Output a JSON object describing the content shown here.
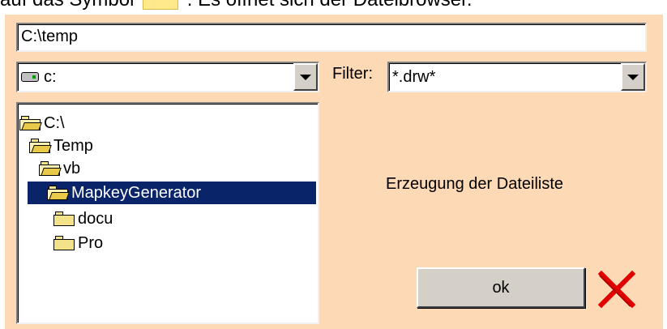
{
  "caption": {
    "prefix": "auf das Symbol",
    "suffix": ". Es öffnet sich der Dateibrowser."
  },
  "path_input": {
    "value": "C:\\temp"
  },
  "drive_select": {
    "value": "c:",
    "icon": "drive-icon"
  },
  "filter": {
    "label": "Filter:",
    "value": "*.drw*"
  },
  "tree": {
    "items": [
      {
        "label": "C:\\",
        "icon": "open-folder-icon",
        "selected": false
      },
      {
        "label": "Temp",
        "icon": "open-folder-icon",
        "selected": false
      },
      {
        "label": "vb",
        "icon": "open-folder-icon",
        "selected": false
      },
      {
        "label": "MapkeyGenerator",
        "icon": "open-folder-icon",
        "selected": true
      },
      {
        "label": "docu",
        "icon": "folder-icon",
        "selected": false
      },
      {
        "label": "Pro",
        "icon": "folder-icon",
        "selected": false
      }
    ]
  },
  "status": {
    "text": "Erzeugung der Dateiliste"
  },
  "ok_button": {
    "label": "ok"
  },
  "colors": {
    "panel": "#fdd9b5",
    "selection": "#0a246a",
    "close_x": "#e00000"
  }
}
